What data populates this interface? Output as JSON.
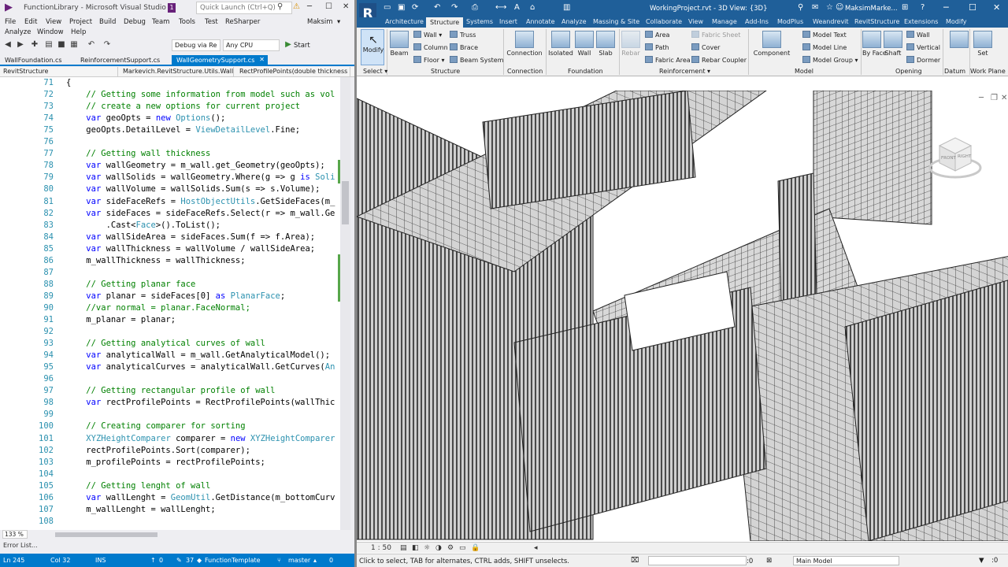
{
  "vs": {
    "title": "FunctionLibrary - Microsoft Visual Studio",
    "notification_count": "1",
    "quick_launch_placeholder": "Quick Launch (Ctrl+Q)",
    "user": "Maksim",
    "menu": [
      "File",
      "Edit",
      "View",
      "Project",
      "Build",
      "Debug",
      "Team",
      "Tools",
      "Test",
      "ReSharper",
      "Analyze",
      "Window",
      "Help"
    ],
    "toolbar": {
      "config": "Debug via Re",
      "platform": "Any CPU",
      "start_label": "Start"
    },
    "tabs": [
      {
        "label": "WallFoundation.cs",
        "active": false
      },
      {
        "label": "ReinforcementSupport.cs",
        "active": false
      },
      {
        "label": "WallGeometrySupport.cs",
        "active": true
      }
    ],
    "navbar": {
      "project": "RevitStructure",
      "class": "Markevich.RevitStructure.Utils.Wall",
      "member": "RectProfilePoints(double thickness"
    },
    "code": {
      "line_numbers": [
        "71",
        "72",
        "73",
        "74",
        "75",
        "76",
        "77",
        "78",
        "79",
        "80",
        "81",
        "82",
        "83",
        "84",
        "85",
        "86",
        "87",
        "88",
        "89",
        "90",
        "91",
        "92",
        "93",
        "94",
        "95",
        "96",
        "97",
        "98",
        "99",
        "100",
        "101",
        "102",
        "103",
        "104",
        "105",
        "106",
        "107",
        "108"
      ],
      "lines": [
        [
          {
            "t": "{",
            "c": ""
          }
        ],
        [
          {
            "t": "    // Getting some information from model such as vol",
            "c": "cm"
          }
        ],
        [
          {
            "t": "    // create a new options for current project",
            "c": "cm"
          }
        ],
        [
          {
            "t": "    ",
            "c": ""
          },
          {
            "t": "var",
            "c": "kw"
          },
          {
            "t": " geoOpts = ",
            "c": ""
          },
          {
            "t": "new",
            "c": "kw"
          },
          {
            "t": " ",
            "c": ""
          },
          {
            "t": "Options",
            "c": "ty"
          },
          {
            "t": "();",
            "c": ""
          }
        ],
        [
          {
            "t": "    geoOpts.DetailLevel = ",
            "c": ""
          },
          {
            "t": "ViewDetailLevel",
            "c": "ty"
          },
          {
            "t": ".Fine;",
            "c": ""
          }
        ],
        [
          {
            "t": "",
            "c": ""
          }
        ],
        [
          {
            "t": "    // Getting wall thickness",
            "c": "cm"
          }
        ],
        [
          {
            "t": "    ",
            "c": ""
          },
          {
            "t": "var",
            "c": "kw"
          },
          {
            "t": " wallGeometry = m_wall.get_Geometry(geoOpts);",
            "c": ""
          }
        ],
        [
          {
            "t": "    ",
            "c": ""
          },
          {
            "t": "var",
            "c": "kw"
          },
          {
            "t": " wallSolids = wallGeometry.Where(g => g ",
            "c": ""
          },
          {
            "t": "is",
            "c": "kw"
          },
          {
            "t": " ",
            "c": ""
          },
          {
            "t": "Soli",
            "c": "ty"
          }
        ],
        [
          {
            "t": "    ",
            "c": ""
          },
          {
            "t": "var",
            "c": "kw"
          },
          {
            "t": " wallVolume = wallSolids.Sum(s => s.Volume);",
            "c": ""
          }
        ],
        [
          {
            "t": "    ",
            "c": ""
          },
          {
            "t": "var",
            "c": "kw"
          },
          {
            "t": " sideFaceRefs = ",
            "c": ""
          },
          {
            "t": "HostObjectUtils",
            "c": "ty"
          },
          {
            "t": ".GetSideFaces(m_",
            "c": ""
          }
        ],
        [
          {
            "t": "    ",
            "c": ""
          },
          {
            "t": "var",
            "c": "kw"
          },
          {
            "t": " sideFaces = sideFaceRefs.Select(r => m_wall.Ge",
            "c": ""
          }
        ],
        [
          {
            "t": "        .Cast<",
            "c": ""
          },
          {
            "t": "Face",
            "c": "ty"
          },
          {
            "t": ">().ToList();",
            "c": ""
          }
        ],
        [
          {
            "t": "    ",
            "c": ""
          },
          {
            "t": "var",
            "c": "kw"
          },
          {
            "t": " wallSideArea = sideFaces.Sum(f => f.Area);",
            "c": ""
          }
        ],
        [
          {
            "t": "    ",
            "c": ""
          },
          {
            "t": "var",
            "c": "kw"
          },
          {
            "t": " wallThickness = wallVolume / wallSideArea;",
            "c": ""
          }
        ],
        [
          {
            "t": "    m_wallThickness = wallThickness;",
            "c": ""
          }
        ],
        [
          {
            "t": "",
            "c": ""
          }
        ],
        [
          {
            "t": "    // Getting planar face",
            "c": "cm"
          }
        ],
        [
          {
            "t": "    ",
            "c": ""
          },
          {
            "t": "var",
            "c": "kw"
          },
          {
            "t": " planar = sideFaces[0] ",
            "c": ""
          },
          {
            "t": "as",
            "c": "kw"
          },
          {
            "t": " ",
            "c": ""
          },
          {
            "t": "PlanarFace",
            "c": "ty"
          },
          {
            "t": ";",
            "c": ""
          }
        ],
        [
          {
            "t": "    //var normal = planar.FaceNormal;",
            "c": "cm"
          }
        ],
        [
          {
            "t": "    m_planar = planar;",
            "c": ""
          }
        ],
        [
          {
            "t": "",
            "c": ""
          }
        ],
        [
          {
            "t": "    // Getting analytical curves of wall",
            "c": "cm"
          }
        ],
        [
          {
            "t": "    ",
            "c": ""
          },
          {
            "t": "var",
            "c": "kw"
          },
          {
            "t": " analyticalWall = m_wall.GetAnalyticalModel();",
            "c": ""
          }
        ],
        [
          {
            "t": "    ",
            "c": ""
          },
          {
            "t": "var",
            "c": "kw"
          },
          {
            "t": " analyticalCurves = analyticalWall.GetCurves(",
            "c": ""
          },
          {
            "t": "An",
            "c": "ty"
          }
        ],
        [
          {
            "t": "",
            "c": ""
          }
        ],
        [
          {
            "t": "    // Getting rectangular profile of wall",
            "c": "cm"
          }
        ],
        [
          {
            "t": "    ",
            "c": ""
          },
          {
            "t": "var",
            "c": "kw"
          },
          {
            "t": " rectProfilePoints = RectProfilePoints(wallThic",
            "c": ""
          }
        ],
        [
          {
            "t": "",
            "c": ""
          }
        ],
        [
          {
            "t": "    // Creating comparer for sorting",
            "c": "cm"
          }
        ],
        [
          {
            "t": "    ",
            "c": ""
          },
          {
            "t": "XYZHeightComparer",
            "c": "ty"
          },
          {
            "t": " comparer = ",
            "c": ""
          },
          {
            "t": "new",
            "c": "kw"
          },
          {
            "t": " ",
            "c": ""
          },
          {
            "t": "XYZHeightComparer",
            "c": "ty"
          }
        ],
        [
          {
            "t": "    rectProfilePoints.Sort(comparer);",
            "c": ""
          }
        ],
        [
          {
            "t": "    m_profilePoints = rectProfilePoints;",
            "c": ""
          }
        ],
        [
          {
            "t": "",
            "c": ""
          }
        ],
        [
          {
            "t": "    // Getting lenght of wall",
            "c": "cm"
          }
        ],
        [
          {
            "t": "    ",
            "c": ""
          },
          {
            "t": "var",
            "c": "kw"
          },
          {
            "t": " wallLenght = ",
            "c": ""
          },
          {
            "t": "GeomUtil",
            "c": "ty"
          },
          {
            "t": ".GetDistance(m_bottomCurv",
            "c": ""
          }
        ],
        [
          {
            "t": "    m_wallLenght = wallLenght;",
            "c": ""
          }
        ],
        [
          {
            "t": "",
            "c": ""
          }
        ]
      ]
    },
    "zoom": "133 %",
    "error_list": "Error List...",
    "status": {
      "line": "Ln 245",
      "col": "Col 32",
      "mode": "INS",
      "up_count": "0",
      "changes": "37",
      "project": "FunctionTemplate",
      "branch": "master",
      "pending": "0"
    }
  },
  "revit": {
    "logo": "R",
    "title": "WorkingProject.rvt - 3D View: {3D}",
    "user": "MaksimMarke...",
    "tabs": [
      "Architecture",
      "Structure",
      "Systems",
      "Insert",
      "Annotate",
      "Analyze",
      "Massing & Site",
      "Collaborate",
      "View",
      "Manage",
      "Add-Ins",
      "ModPlus",
      "Weandrevit",
      "RevitStructure",
      "Extensions",
      "Modify"
    ],
    "active_tab": "Structure",
    "ribbon": {
      "modify": "Modify",
      "beam": "Beam",
      "wall": "Wall",
      "column": "Column",
      "floor": "Floor",
      "truss": "Truss",
      "brace": "Brace",
      "beam_system": "Beam System",
      "connection": "Connection",
      "isolated": "Isolated",
      "wall_fnd": "Wall",
      "slab": "Slab",
      "rebar": "Rebar",
      "area": "Area",
      "path": "Path",
      "fabric_area": "Fabric Area",
      "fabric_sheet": "Fabric Sheet",
      "cover": "Cover",
      "rebar_coupler": "Rebar Coupler",
      "component": "Component",
      "model_text": "Model Text",
      "model_line": "Model Line",
      "model_group": "Model Group",
      "by_face": "By Face",
      "shaft": "Shaft",
      "op_wall": "Wall",
      "vertical": "Vertical",
      "dormer": "Dormer",
      "set": "Set",
      "panels": {
        "select": "Select",
        "structure": "Structure",
        "connection": "Connection",
        "foundation": "Foundation",
        "reinforcement": "Reinforcement",
        "model": "Model",
        "opening": "Opening",
        "datum": "Datum",
        "work_plane": "Work Plane"
      }
    },
    "viewcube": {
      "front": "FRONT",
      "right": "RIGHT"
    },
    "scale": "1 : 50",
    "status_text": "Click to select, TAB for alternates, CTRL adds, SHIFT unselects.",
    "workset_value": ":0",
    "model_dropdown": "Main Model"
  }
}
